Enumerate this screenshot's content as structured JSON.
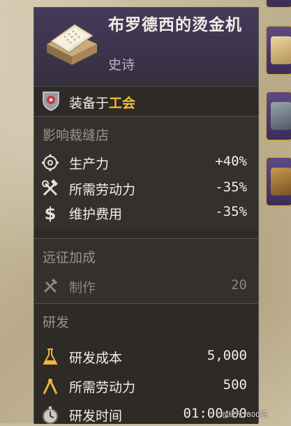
{
  "item": {
    "title": "布罗德西的烫金机",
    "rarity": "史诗"
  },
  "equip": {
    "prefix": "装备于",
    "target": "工会"
  },
  "sections": {
    "workshop": {
      "title": "影响裁缝店",
      "rows": [
        {
          "icon": "gear-icon",
          "label": "生产力",
          "value": "+40%"
        },
        {
          "icon": "tools-icon",
          "label": "所需劳动力",
          "value": "-35%"
        },
        {
          "icon": "dollar-icon",
          "label": "维护费用",
          "value": "-35%"
        }
      ]
    },
    "expedition": {
      "title": "远征加成",
      "rows": [
        {
          "icon": "crafting-icon",
          "label": "制作",
          "value": "20"
        }
      ]
    },
    "research": {
      "title": "研发",
      "rows": [
        {
          "icon": "flask-icon",
          "label": "研发成本",
          "value": "5,000"
        },
        {
          "icon": "compass-icon",
          "label": "所需劳动力",
          "value": "500"
        },
        {
          "icon": "stopwatch-icon",
          "label": "研发时间",
          "value": "01:00:00"
        }
      ]
    }
  },
  "watermark": "@纪元1800吧",
  "colors": {
    "highlight": "#f6be2c",
    "panel": "#2d2a27",
    "header": "#443a5a"
  }
}
